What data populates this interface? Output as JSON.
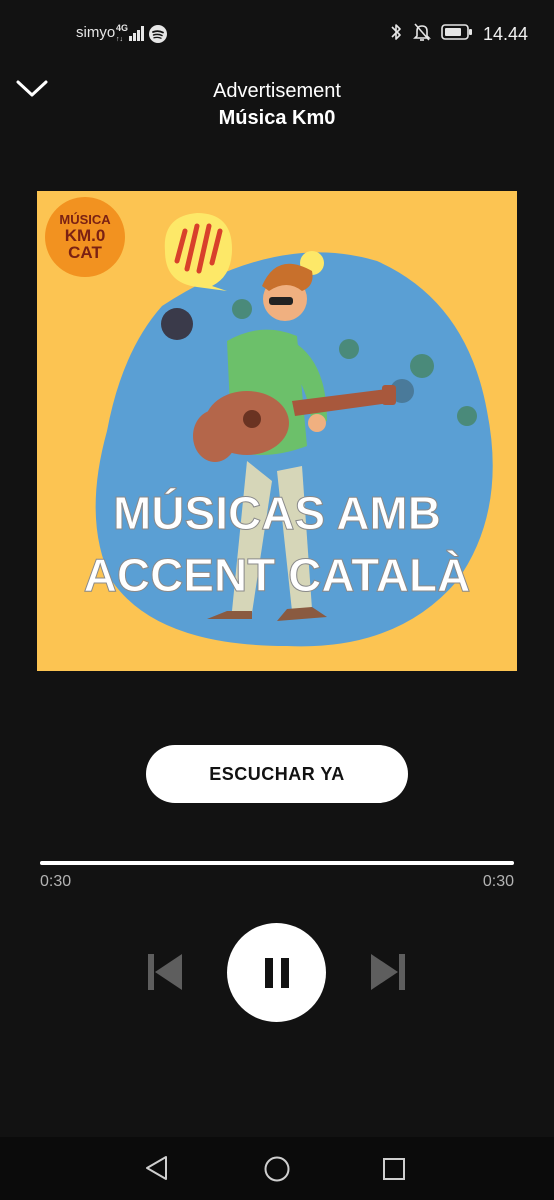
{
  "status_bar": {
    "carrier": "simyo",
    "network": "4G",
    "time": "14.44",
    "icons": [
      "signal-icon",
      "spotify-icon",
      "bluetooth-icon",
      "mute-bell-icon",
      "battery-icon"
    ]
  },
  "header": {
    "title": "Advertisement",
    "subtitle": "Música Km0",
    "collapse_icon": "chevron-down-icon"
  },
  "artwork": {
    "logo_lines": [
      "MÚSICA",
      "KM.0",
      "CAT"
    ],
    "headline_line1": "MÚSICAS AMB",
    "headline_line2": "ACCENT CATALÀ",
    "colors": {
      "background": "#fcc452",
      "blob": "#5a9fd4",
      "logo": "#f29220",
      "logo_text": "#7a2113",
      "bubble": "#fde868",
      "bubble_stripes": "#d8402b"
    }
  },
  "cta": {
    "label": "ESCUCHAR YA"
  },
  "playback": {
    "elapsed": "0:30",
    "total": "0:30",
    "progress": 1.0
  },
  "controls": {
    "previous_icon": "skip-previous-icon",
    "pause_icon": "pause-icon",
    "next_icon": "skip-next-icon"
  },
  "colors": {
    "background": "#121212",
    "text": "#ffffff",
    "muted_text": "#b3b3b3",
    "disabled_control": "#5e5e5e"
  }
}
